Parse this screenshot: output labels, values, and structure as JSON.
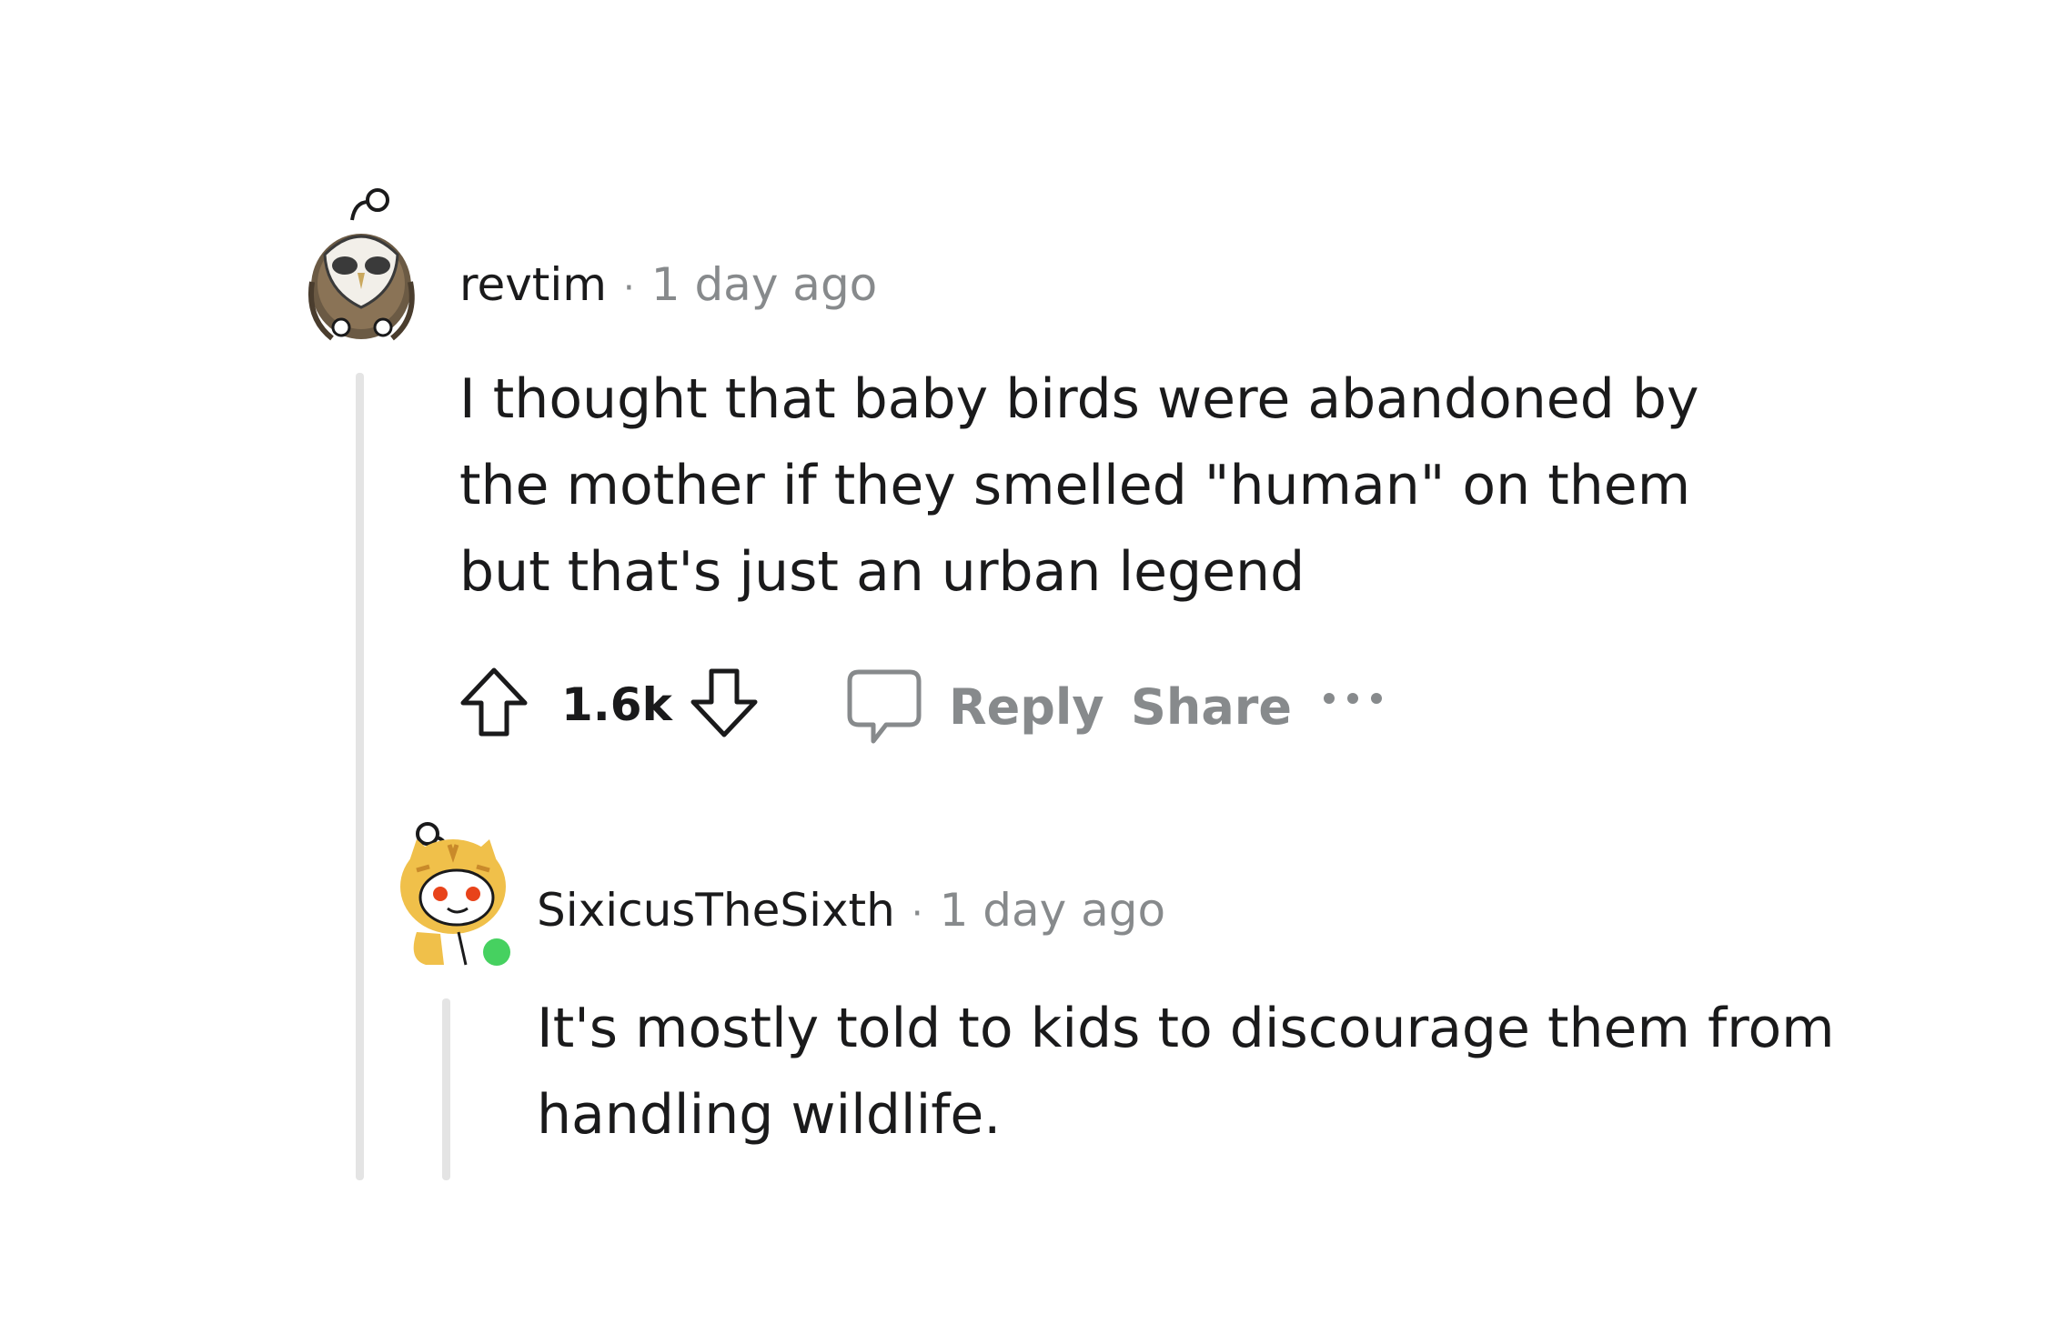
{
  "comment": {
    "author": "revtim",
    "separator": "·",
    "time": "1 day ago",
    "body": "I thought that baby birds were abandoned by the mother if they smelled \"human\" on them but that's just an urban legend",
    "votes": "1.6k",
    "reply_label": "Reply",
    "share_label": "Share",
    "avatar_icon": "owl-snoo-avatar",
    "upvote_icon": "upvote-arrow-icon",
    "downvote_icon": "downvote-arrow-icon",
    "comment_icon": "speech-bubble-icon",
    "more_icon": "ellipsis-icon"
  },
  "reply": {
    "author": "SixicusTheSixth",
    "separator": "·",
    "time": "1 day ago",
    "body": "It's mostly told to kids to discourage them from handling wildlife.",
    "avatar_icon": "tiger-snoo-avatar",
    "online_status": true,
    "online_color": "#46d160"
  }
}
